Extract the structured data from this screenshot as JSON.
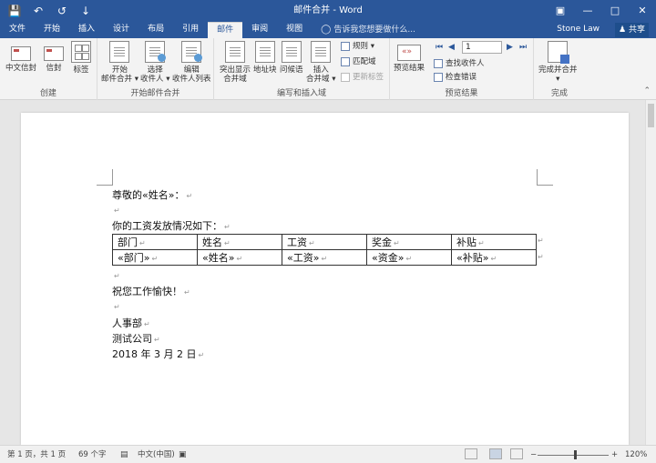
{
  "titlebar": {
    "title": "邮件合并 - Word",
    "save_icon": "save-icon",
    "undo_icon": "undo-icon",
    "redo_icon": "redo-icon"
  },
  "tabs": [
    "文件",
    "开始",
    "插入",
    "设计",
    "布局",
    "引用",
    "邮件",
    "审阅",
    "视图"
  ],
  "active_tab": "邮件",
  "tellme": "告诉我您想要做什么...",
  "user": "Stone Law",
  "share": "共享",
  "ribbon": {
    "groups": {
      "create": "创建",
      "start": "开始邮件合并",
      "write": "编写和插入域",
      "preview": "预览结果",
      "finish": "完成"
    },
    "buttons": {
      "zh_envelope": "中文信封",
      "envelope": "信封",
      "labels": "标签",
      "start_merge_1": "开始",
      "start_merge_2": "邮件合并 ▾",
      "select_recipients_1": "选择",
      "select_recipients_2": "收件人 ▾",
      "edit_list_1": "编辑",
      "edit_list_2": "收件人列表",
      "highlight_1": "突出显示",
      "highlight_2": "合并域",
      "address_block": "地址块",
      "greeting": "问候语",
      "insert_field_1": "插入",
      "insert_field_2": "合并域 ▾",
      "rules": "规则 ▾",
      "match_fields": "匹配域",
      "update_labels": "更新标签",
      "preview_results": "预览结果",
      "record_number": "1",
      "find_recipient": "查找收件人",
      "check_errors": "检查错误",
      "finish_merge_1": "完成并合并",
      "finish_merge_2": "▾"
    }
  },
  "document": {
    "greeting": "尊敬的«姓名»：",
    "intro": "你的工资发放情况如下：",
    "table_headers": [
      "部门",
      "姓名",
      "工资",
      "奖金",
      "补贴"
    ],
    "table_fields": [
      "«部门»",
      "«姓名»",
      "«工资»",
      "«资金»",
      "«补贴»"
    ],
    "wish": "祝您工作愉快！",
    "dept": "人事部",
    "company": "测试公司",
    "date": "2018 年 3 月 2 日",
    "para_mark": "↵"
  },
  "status": {
    "page": "第 1 页，共 1 页",
    "words": "69 个字",
    "language": "中文(中国)",
    "zoom": "120%"
  },
  "colors": {
    "brand": "#2b579a",
    "ribbon": "#f3f3f3"
  }
}
